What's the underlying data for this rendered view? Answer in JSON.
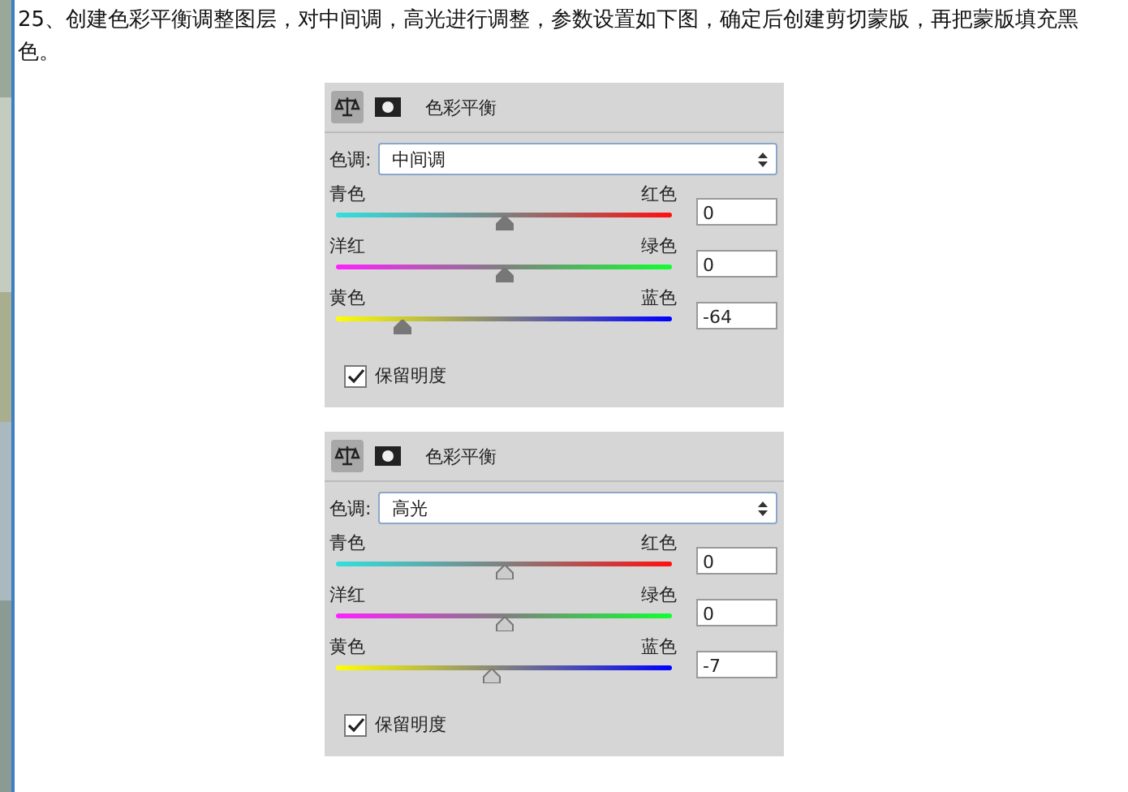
{
  "intro": "25、创建色彩平衡调整图层，对中间调，高光进行调整，参数设置如下图，确定后创建剪切蒙版，再把蒙版填充黑色。",
  "panels": [
    {
      "title": "色彩平衡",
      "tone_label": "色调:",
      "tone": "中间调",
      "sliders": [
        {
          "left": "青色",
          "right": "红色",
          "level": 0.5,
          "value": "0"
        },
        {
          "left": "洋红",
          "right": "绿色",
          "level": 0.5,
          "value": "0"
        },
        {
          "left": "黄色",
          "right": "蓝色",
          "level": 0.18,
          "value": "-64"
        }
      ],
      "preserve": {
        "label": "保留明度",
        "checked": true
      }
    },
    {
      "title": "色彩平衡",
      "tone_label": "色调:",
      "tone": "高光",
      "sliders": [
        {
          "left": "青色",
          "right": "红色",
          "level": 0.5,
          "value": "0"
        },
        {
          "left": "洋红",
          "right": "绿色",
          "level": 0.5,
          "value": "0"
        },
        {
          "left": "黄色",
          "right": "蓝色",
          "level": 0.46,
          "value": "-7"
        }
      ],
      "preserve": {
        "label": "保留明度",
        "checked": true
      }
    }
  ]
}
